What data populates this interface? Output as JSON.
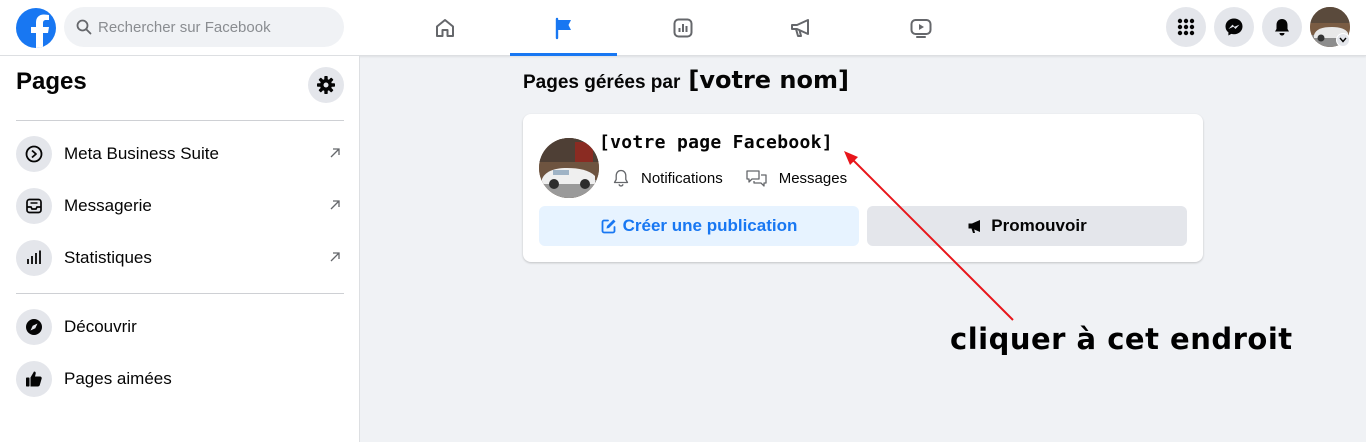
{
  "header": {
    "search_placeholder": "Rechercher sur Facebook",
    "nav_tabs": [
      "home-icon",
      "pages-flag-icon",
      "insights-icon",
      "ads-megaphone-icon",
      "watch-icon"
    ],
    "active_tab": "pages-flag-icon",
    "actions": [
      "menu-grid-icon",
      "messenger-icon",
      "notifications-bell-icon",
      "account-avatar"
    ]
  },
  "sidebar": {
    "title": "Pages",
    "items": [
      {
        "label": "Meta Business Suite",
        "icon": "business-suite-icon",
        "external": true
      },
      {
        "label": "Messagerie",
        "icon": "inbox-icon",
        "external": true
      },
      {
        "label": "Statistiques",
        "icon": "stats-icon",
        "external": true
      },
      {
        "label": "Découvrir",
        "icon": "compass-icon",
        "external": false
      },
      {
        "label": "Pages aimées",
        "icon": "thumbs-up-icon",
        "external": false
      }
    ]
  },
  "main": {
    "title_prefix": "Pages gérées par",
    "title_name": "[votre nom]",
    "card": {
      "page_name": "[votre page Facebook]",
      "notifications_label": "Notifications",
      "messages_label": "Messages",
      "create_post_label": "Créer une publication",
      "promote_label": "Promouvoir"
    }
  },
  "annotation": {
    "text": "cliquer à cet endroit",
    "color": "#e8161b"
  },
  "colors": {
    "brand": "#1877f2",
    "background": "#f0f2f5"
  }
}
